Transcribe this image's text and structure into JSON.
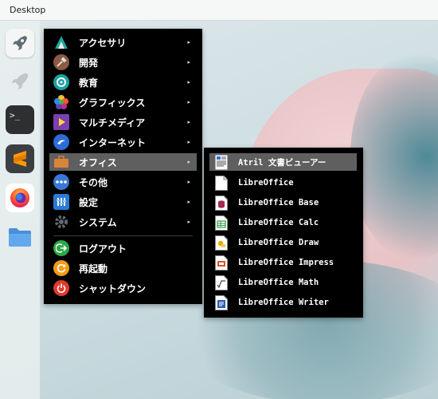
{
  "window": {
    "title": "Desktop"
  },
  "dock": {
    "items": [
      {
        "icon": "rocket-icon"
      },
      {
        "icon": "rocket-outline-icon"
      },
      {
        "icon": "terminal-icon",
        "text": ">_"
      },
      {
        "icon": "sublime-text-icon"
      },
      {
        "icon": "firefox-icon"
      },
      {
        "icon": "folder-icon"
      }
    ]
  },
  "main_menu": {
    "items": [
      {
        "label": "アクセサリ",
        "icon": "accessories-icon",
        "has_submenu": true
      },
      {
        "label": "開発",
        "icon": "development-icon",
        "has_submenu": true
      },
      {
        "label": "教育",
        "icon": "education-icon",
        "has_submenu": true
      },
      {
        "label": "グラフィックス",
        "icon": "graphics-icon",
        "has_submenu": true
      },
      {
        "label": "マルチメディア",
        "icon": "multimedia-icon",
        "has_submenu": true
      },
      {
        "label": "インターネット",
        "icon": "internet-icon",
        "has_submenu": true
      },
      {
        "label": "オフィス",
        "icon": "office-icon",
        "has_submenu": true,
        "selected": true
      },
      {
        "label": "その他",
        "icon": "other-icon",
        "has_submenu": true
      },
      {
        "label": "設定",
        "icon": "settings-icon",
        "has_submenu": true
      },
      {
        "label": "システム",
        "icon": "system-icon",
        "has_submenu": true
      }
    ],
    "session": [
      {
        "label": "ログアウト",
        "icon": "logout-icon"
      },
      {
        "label": "再起動",
        "icon": "restart-icon"
      },
      {
        "label": "シャットダウン",
        "icon": "shutdown-icon"
      }
    ],
    "arrow": "▸"
  },
  "office_submenu": {
    "items": [
      {
        "label": "Atril 文書ビューアー",
        "icon": "atril-icon",
        "selected": true
      },
      {
        "label": "LibreOffice",
        "icon": "libreoffice-icon"
      },
      {
        "label": "LibreOffice Base",
        "icon": "libreoffice-base-icon"
      },
      {
        "label": "LibreOffice Calc",
        "icon": "libreoffice-calc-icon"
      },
      {
        "label": "LibreOffice Draw",
        "icon": "libreoffice-draw-icon"
      },
      {
        "label": "LibreOffice Impress",
        "icon": "libreoffice-impress-icon"
      },
      {
        "label": "LibreOffice Math",
        "icon": "libreoffice-math-icon"
      },
      {
        "label": "LibreOffice Writer",
        "icon": "libreoffice-writer-icon"
      }
    ]
  },
  "colors": {
    "menu_bg": "#000000",
    "menu_selected": "#5f5f5f",
    "calc": "#2f9e44",
    "draw": "#e6a800",
    "impress": "#d9532f",
    "writer": "#2b5fb4",
    "base": "#a32a51"
  }
}
